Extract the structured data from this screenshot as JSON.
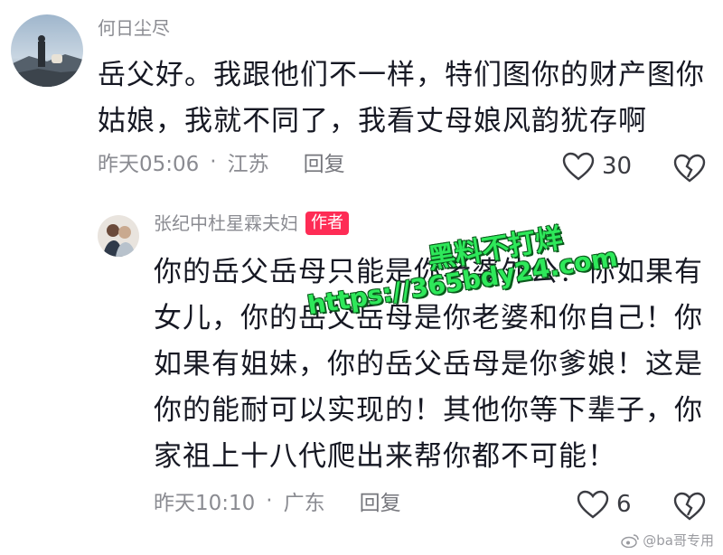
{
  "comment1": {
    "username": "何日尘尽",
    "text_lines": [
      "岳父好。我跟他们不一样，特们图你的财产图你",
      "姑娘，我就不同了，我看丈母娘风韵犹存啊"
    ],
    "time": "昨天05:06",
    "location": "江苏",
    "reply_label": "回复",
    "like_count": "30"
  },
  "comment2": {
    "username": "张纪中杜星霖夫妇",
    "author_tag": "作者",
    "text_lines": [
      "你的岳父岳母只能是你老婆外公！你如果有",
      "女儿，你的岳父岳母是你老婆和你自己！你",
      "如果有姐妹，你的岳父岳母是你爹娘！这是",
      "你的能耐可以实现的！其他你等下辈子，你",
      "家祖上十八代爬出来帮你都不可能！"
    ],
    "time": "昨天10:10",
    "location": "广东",
    "reply_label": "回复",
    "like_count": "6"
  },
  "watermark": {
    "line1": "黑料不打烊",
    "line2": "https://365bdy24.com"
  },
  "credit": "@ba哥专用",
  "icons": {
    "like": "heart-outline-icon",
    "dislike": "broken-heart-icon",
    "weibo": "weibo-logo-icon"
  },
  "colors": {
    "author_tag": "#fe2c55",
    "meta_gray": "#8a8b91",
    "watermark_green": "#2ee85a"
  }
}
